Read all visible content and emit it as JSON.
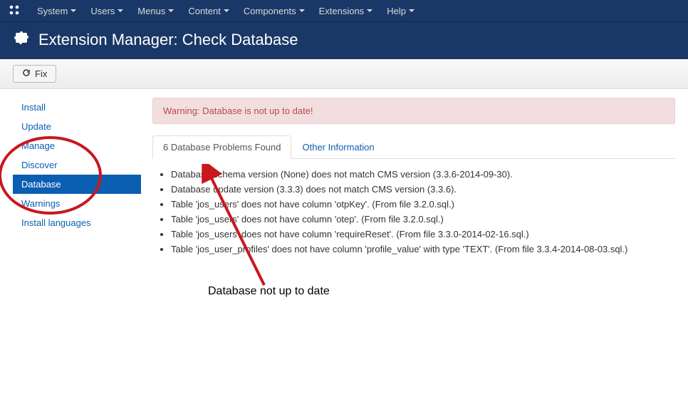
{
  "topmenu": {
    "items": [
      {
        "label": "System"
      },
      {
        "label": "Users"
      },
      {
        "label": "Menus"
      },
      {
        "label": "Content"
      },
      {
        "label": "Components"
      },
      {
        "label": "Extensions"
      },
      {
        "label": "Help"
      }
    ]
  },
  "header": {
    "title": "Extension Manager: Check Database"
  },
  "toolbar": {
    "fix_label": "Fix"
  },
  "sidebar": {
    "items": [
      {
        "label": "Install",
        "active": false
      },
      {
        "label": "Update",
        "active": false
      },
      {
        "label": "Manage",
        "active": false
      },
      {
        "label": "Discover",
        "active": false
      },
      {
        "label": "Database",
        "active": true
      },
      {
        "label": "Warnings",
        "active": false
      },
      {
        "label": "Install languages",
        "active": false
      }
    ]
  },
  "alert": {
    "text": "Warning: Database is not up to date!"
  },
  "tabs": {
    "problems_label": "6 Database Problems Found",
    "other_label": "Other Information"
  },
  "problems": {
    "items": [
      "Database schema version (None) does not match CMS version (3.3.6-2014-09-30).",
      "Database update version (3.3.3) does not match CMS version (3.3.6).",
      "Table 'jos_users' does not have column 'otpKey'. (From file 3.2.0.sql.)",
      "Table 'jos_users' does not have column 'otep'. (From file 3.2.0.sql.)",
      "Table 'jos_users' does not have column 'requireReset'. (From file 3.3.0-2014-02-16.sql.)",
      "Table 'jos_user_profiles' does not have column 'profile_value' with type 'TEXT'. (From file 3.3.4-2014-08-03.sql.)"
    ]
  },
  "annotation": {
    "caption": "Database not up to date"
  }
}
